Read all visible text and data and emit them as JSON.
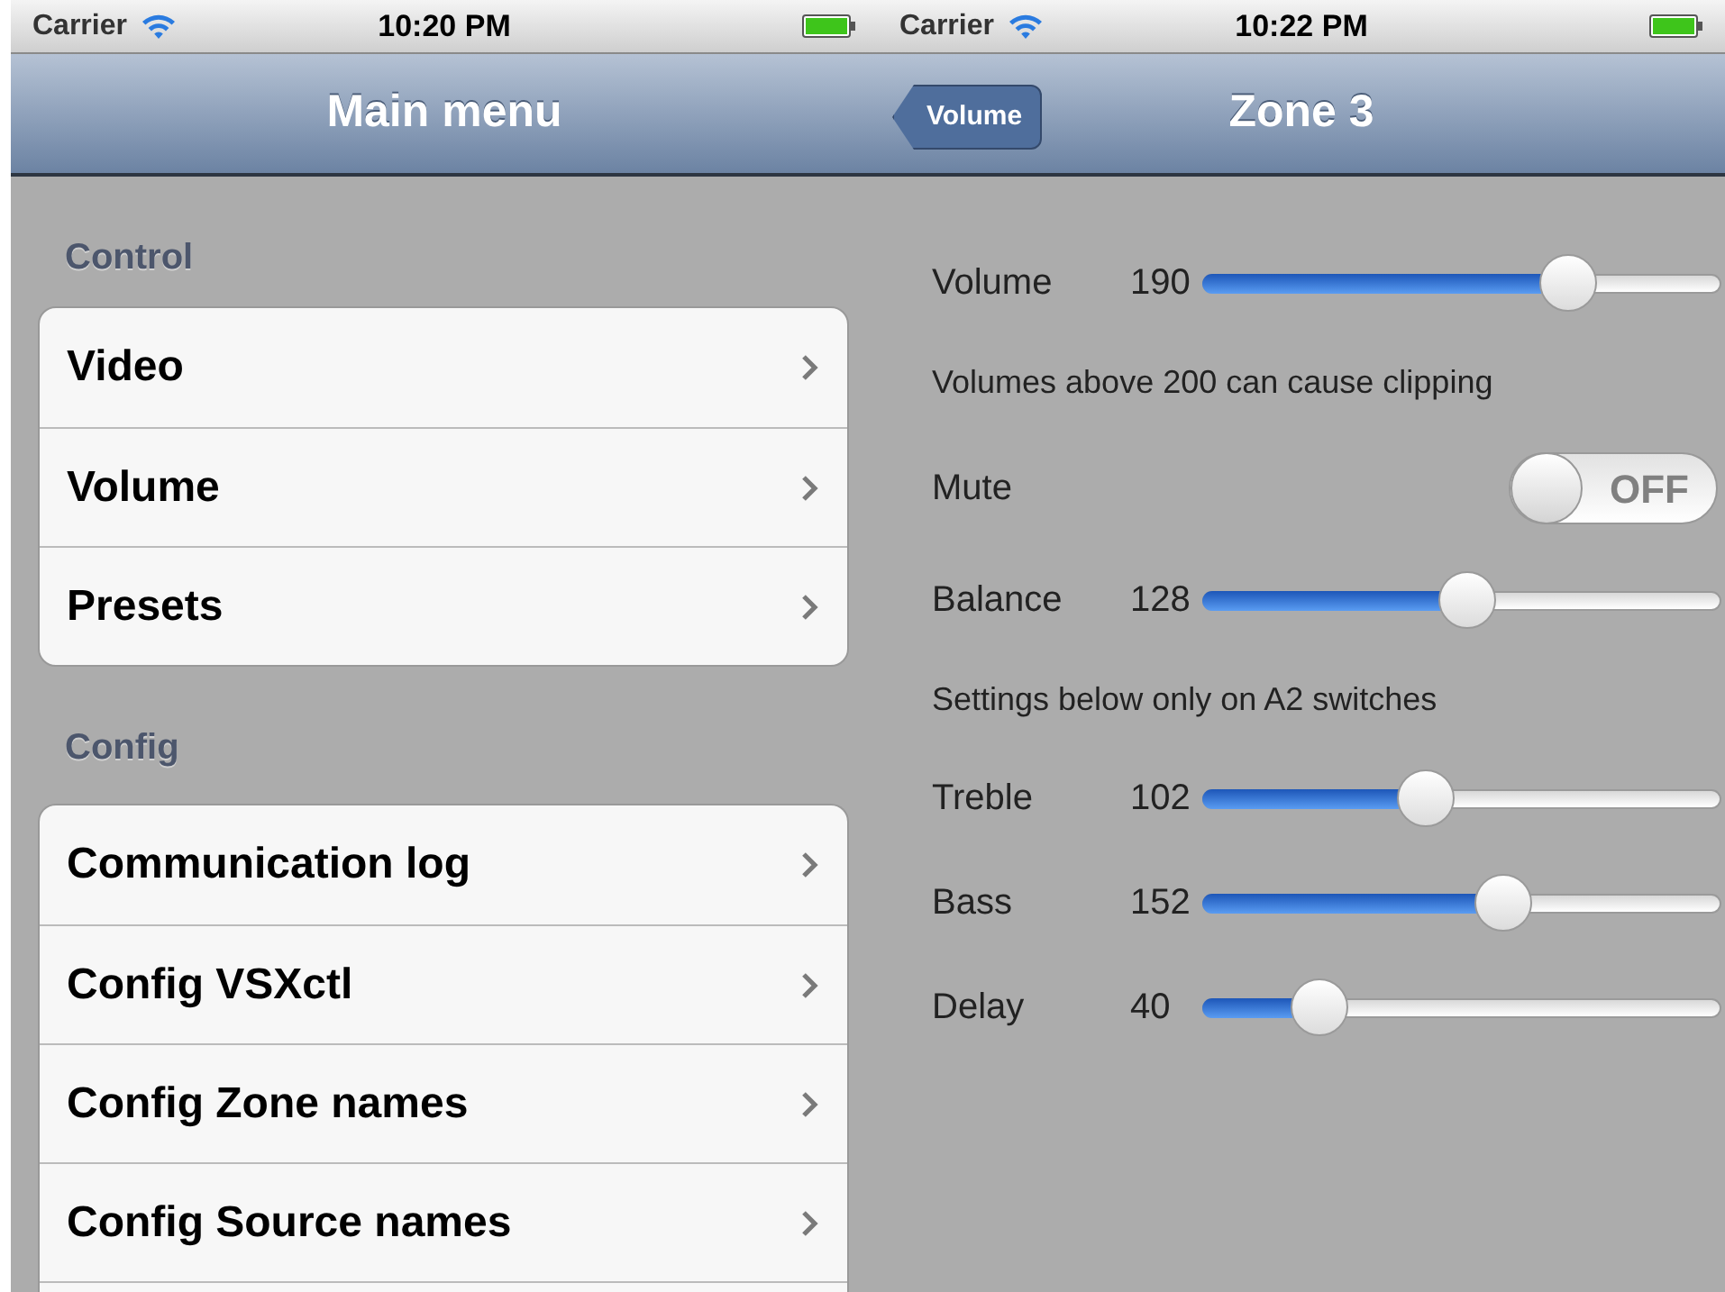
{
  "left_screen": {
    "status_bar": {
      "carrier": "Carrier",
      "time": "10:20 PM"
    },
    "nav_bar": {
      "title": "Main menu"
    },
    "sections": [
      {
        "header": "Control",
        "items": [
          {
            "label": "Video"
          },
          {
            "label": "Volume"
          },
          {
            "label": "Presets"
          }
        ],
        "more_below": false
      },
      {
        "header": "Config",
        "items": [
          {
            "label": "Communication log"
          },
          {
            "label": "Config VSXctl"
          },
          {
            "label": "Config Zone names"
          },
          {
            "label": "Config Source names"
          }
        ],
        "more_below": true
      }
    ]
  },
  "right_screen": {
    "status_bar": {
      "carrier": "Carrier",
      "time": "10:22 PM"
    },
    "nav_bar": {
      "title": "Zone 3",
      "back_button": "Volume"
    },
    "rows": [
      {
        "kind": "slider",
        "label": "Volume",
        "value": "190",
        "level": 0.73
      },
      {
        "kind": "note",
        "text": "Volumes above 200 can cause clipping"
      },
      {
        "kind": "switch",
        "label": "Mute",
        "on": false,
        "state_text": "OFF"
      },
      {
        "kind": "slider",
        "label": "Balance",
        "value": "128",
        "level": 0.51
      },
      {
        "kind": "note",
        "text": "Settings below only on A2 switches"
      },
      {
        "kind": "slider",
        "label": "Treble",
        "value": "102",
        "level": 0.42
      },
      {
        "kind": "slider",
        "label": "Bass",
        "value": "152",
        "level": 0.59
      },
      {
        "kind": "slider",
        "label": "Delay",
        "value": "40",
        "level": 0.19
      }
    ]
  }
}
